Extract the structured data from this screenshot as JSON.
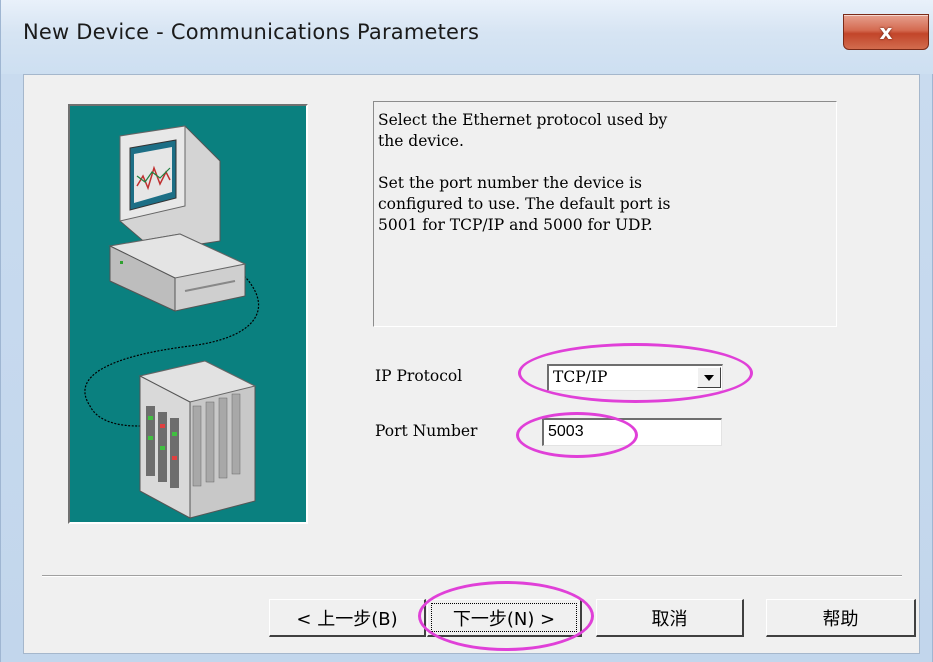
{
  "window": {
    "title": "New Device - Communications Parameters",
    "close_glyph": "x"
  },
  "description": {
    "lines_para1": [
      "Select the Ethernet protocol used by",
      "the device."
    ],
    "lines_para2": [
      "Set the port number the device is",
      "configured to use. The default port is",
      "5001 for TCP/IP and 5000 for UDP."
    ]
  },
  "fields": {
    "ip_protocol_label": "IP Protocol",
    "ip_protocol_value": "TCP/IP",
    "port_label": "Port Number",
    "port_value": "5003"
  },
  "buttons": {
    "back": "< 上一步(B)",
    "next": "下一步(N) >",
    "cancel": "取消",
    "help": "帮助"
  },
  "colors": {
    "highlight_annotation": "#e040d8",
    "picture_background": "#0a807f",
    "close_button": "#c2452a"
  },
  "icons": {
    "close": "close-icon",
    "dropdown": "chevron-down-icon",
    "computer": "computer-icon",
    "device": "device-rack-icon"
  }
}
